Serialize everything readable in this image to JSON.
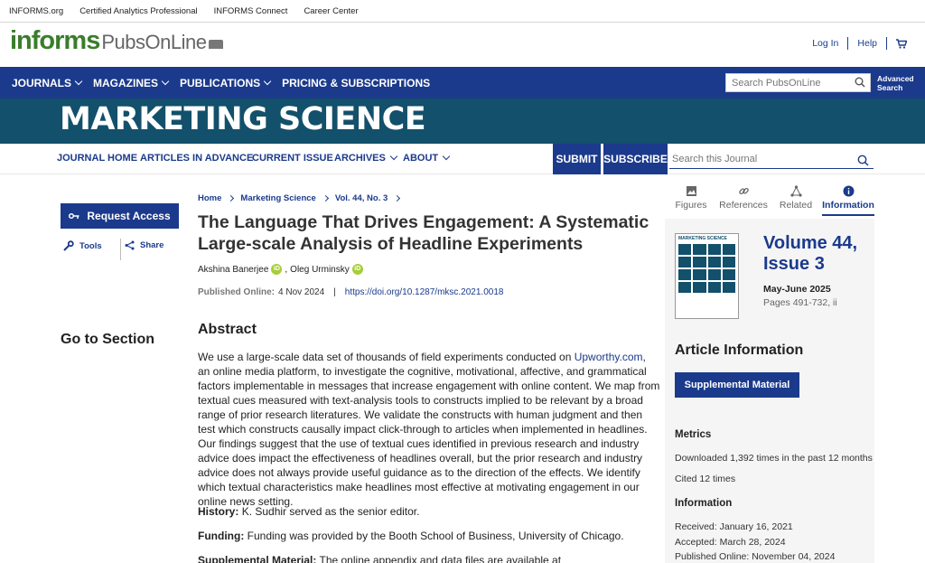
{
  "utility_links": [
    "INFORMS.org",
    "Certified Analytics Professional",
    "INFORMS Connect",
    "Career Center"
  ],
  "logo": {
    "informs": "informs",
    "pubsonline": "PubsOnLine"
  },
  "user_nav": {
    "login": "Log In",
    "help": "Help"
  },
  "main_nav": {
    "items": [
      {
        "label": "JOURNALS"
      },
      {
        "label": "MAGAZINES"
      },
      {
        "label": "PUBLICATIONS"
      },
      {
        "label": "PRICING & SUBSCRIPTIONS"
      }
    ],
    "search_placeholder": "Search PubsOnLine",
    "advanced_search": "Advanced Search"
  },
  "journal": {
    "title": "MARKETING SCIENCE",
    "nav": {
      "journal_home": "JOURNAL HOME",
      "articles_in_advance": "ARTICLES IN ADVANCE",
      "current_issue": "CURRENT ISSUE",
      "archives": "ARCHIVES",
      "about": "ABOUT",
      "submit": "SUBMIT",
      "subscribe": "SUBSCRIBE",
      "search_placeholder": "Search this Journal"
    }
  },
  "left": {
    "request_access": "Request Access",
    "tools": "Tools",
    "share": "Share",
    "go_to_section": "Go to Section"
  },
  "breadcrumb": [
    "Home",
    "Marketing Science",
    "Vol. 44, No. 3"
  ],
  "article": {
    "title": "The Language That Drives Engagement: A Systematic Large-scale Analysis of Headline Experiments",
    "authors": [
      "Akshina Banerjee",
      "Oleg Urminsky"
    ],
    "published_label": "Published Online:",
    "published_date": "4 Nov 2024",
    "doi": "https://doi.org/10.1287/mksc.2021.0018",
    "abstract_heading": "Abstract",
    "abstract_pre": "We use a large-scale data set of thousands of field experiments conducted on ",
    "abstract_link": "Upworthy.com",
    "abstract_post": ", an online media platform, to investigate the cognitive, motivational, affective, and grammatical factors implementable in messages that increase engagement with online content. We map from textual cues measured with text-analysis tools to constructs implied to be relevant by a broad range of prior research literatures. We validate the constructs with human judgment and then test which constructs causally impact click-through to articles when implemented in headlines. Our findings suggest that the use of textual cues identified in previous research and industry advice does impact the effectiveness of headlines overall, but the prior research and industry advice does not always provide useful guidance as to the direction of the effects. We identify which textual characteristics make headlines most effective at motivating engagement in our online news setting.",
    "history_label": "History:",
    "history": "K. Sudhir served as the senior editor.",
    "funding_label": "Funding:",
    "funding": "Funding was provided by the Booth School of Business, University of Chicago.",
    "supp_label": "Supplemental Material:",
    "supp": "The online appendix and data files are available at"
  },
  "sidebar": {
    "tabs": [
      "Figures",
      "References",
      "Related",
      "Information"
    ],
    "cover_title": "MARKETING SCIENCE",
    "volume": "Volume 44,",
    "issue": "Issue 3",
    "issue_date": "May-June 2025",
    "pages": "Pages 491-732, ii",
    "article_info": "Article Information",
    "supplemental_material": "Supplemental Material",
    "metrics_heading": "Metrics",
    "downloads": "Downloaded 1,392 times in the past 12 months",
    "cited": "Cited 12 times",
    "info_heading": "Information",
    "received": "Received: January 16, 2021",
    "accepted": "Accepted: March 28, 2024",
    "published_online": "Published Online: November 04, 2024"
  },
  "colors": {
    "nav_blue": "#1b3a8c",
    "banner_teal": "#12506b",
    "orcid_green": "#a6ce39",
    "logo_green": "#3a7d2c"
  }
}
